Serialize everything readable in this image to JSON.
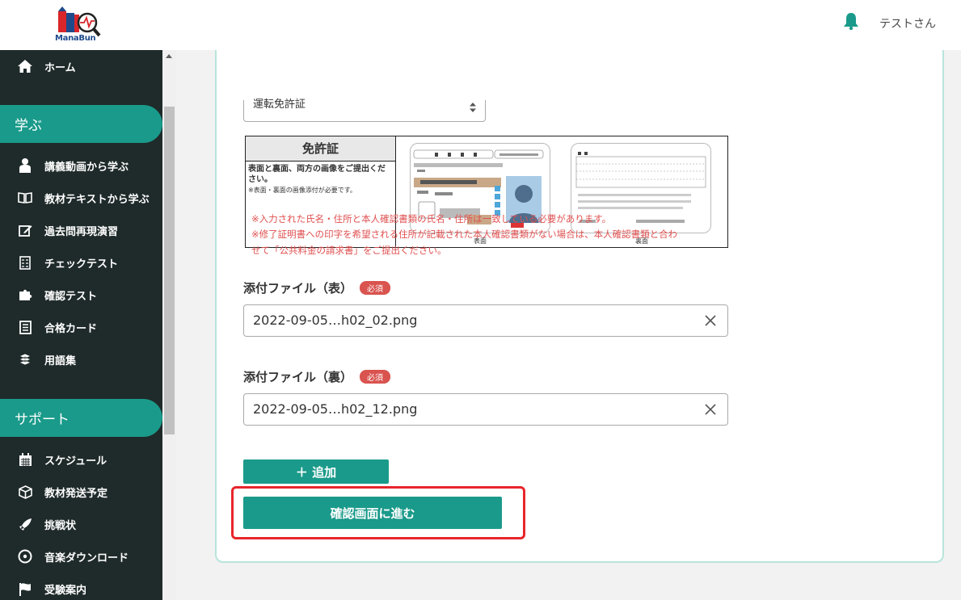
{
  "header": {
    "logo_text": "ManaBun",
    "username": "テストさん"
  },
  "sidebar": {
    "home": "ホーム",
    "section_learn": "学ぶ",
    "learn_items": [
      {
        "label": "講義動画から学ぶ",
        "icon": "student-icon"
      },
      {
        "label": "教材テキストから学ぶ",
        "icon": "book-icon"
      },
      {
        "label": "過去問再現演習",
        "icon": "edit-icon"
      },
      {
        "label": "チェックテスト",
        "icon": "checklist-icon"
      },
      {
        "label": "確認テスト",
        "icon": "puzzle-icon"
      },
      {
        "label": "合格カード",
        "icon": "cards-icon"
      },
      {
        "label": "用語集",
        "icon": "books-stack-icon"
      }
    ],
    "section_support": "サポート",
    "support_items": [
      {
        "label": "スケジュール",
        "icon": "calendar-icon"
      },
      {
        "label": "教材発送予定",
        "icon": "box-icon"
      },
      {
        "label": "挑戦状",
        "icon": "rocket-icon"
      },
      {
        "label": "音楽ダウンロード",
        "icon": "disc-icon"
      },
      {
        "label": "受験案内",
        "icon": "flag-icon"
      }
    ]
  },
  "form": {
    "doc_type_value": "運転免許証",
    "license": {
      "title": "免許証",
      "desc": "表面と裏面、両方の画像をご提出ください。",
      "note": "※表面・裏面の画像添付が必要です。",
      "front_caption": "表面",
      "back_caption": "裏面"
    },
    "warnings": [
      "※入力された氏名・住所と本人確認書類の氏名・住所は一致している必要があります。",
      "※修了証明書への印字を希望される住所が記載された本人確認書類がない場合は、本人確認書類と合わ",
      "せて「公共料金の請求書」をご提出ください。"
    ],
    "front_label": "添付ファイル（表）",
    "back_label": "添付ファイル（裏）",
    "required_badge": "必須",
    "front_file": "2022-09-05…h02_02.png",
    "back_file": "2022-09-05…h02_12.png",
    "add_button": "＋ 追加",
    "confirm_button": "確認画面に進む"
  },
  "colors": {
    "accent": "#1a9a8a",
    "sidebar_bg": "#1f2a2a",
    "warning": "#e05050",
    "badge": "#d9534f",
    "highlight": "#e8262b"
  }
}
